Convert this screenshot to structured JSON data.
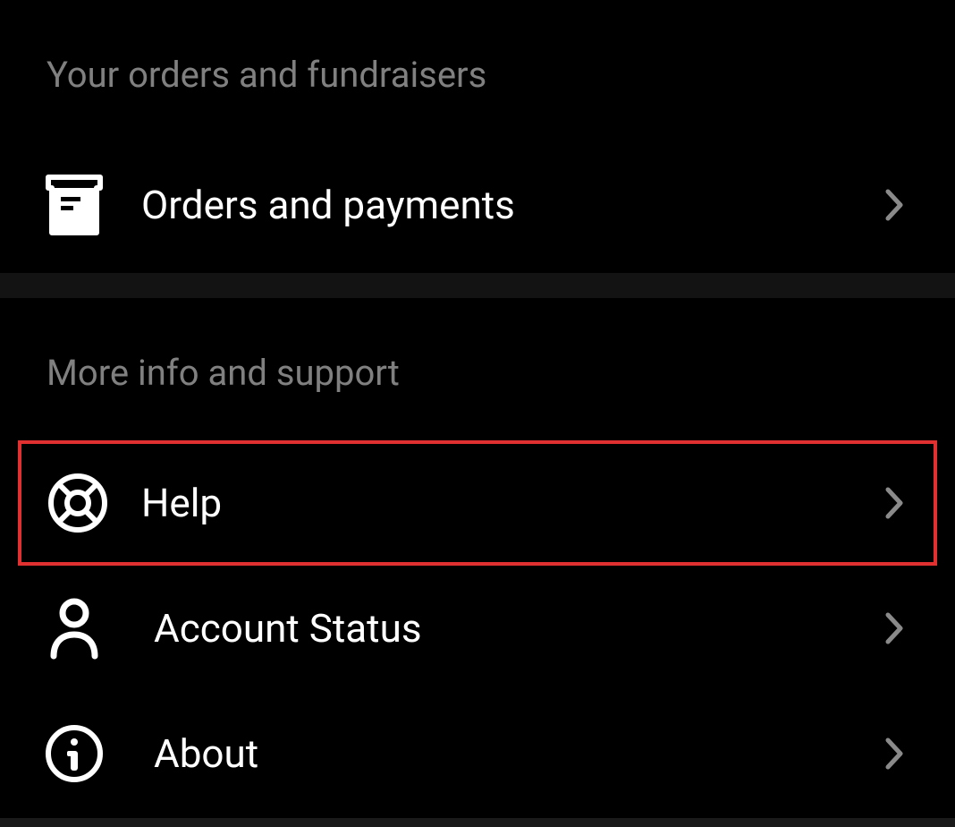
{
  "sections": {
    "orders": {
      "header": "Your orders and fundraisers",
      "items": [
        {
          "label": "Orders and payments"
        }
      ]
    },
    "support": {
      "header": "More info and support",
      "items": [
        {
          "label": "Help"
        },
        {
          "label": "Account Status"
        },
        {
          "label": "About"
        }
      ]
    }
  },
  "highlight": {
    "color": "#e03030"
  }
}
